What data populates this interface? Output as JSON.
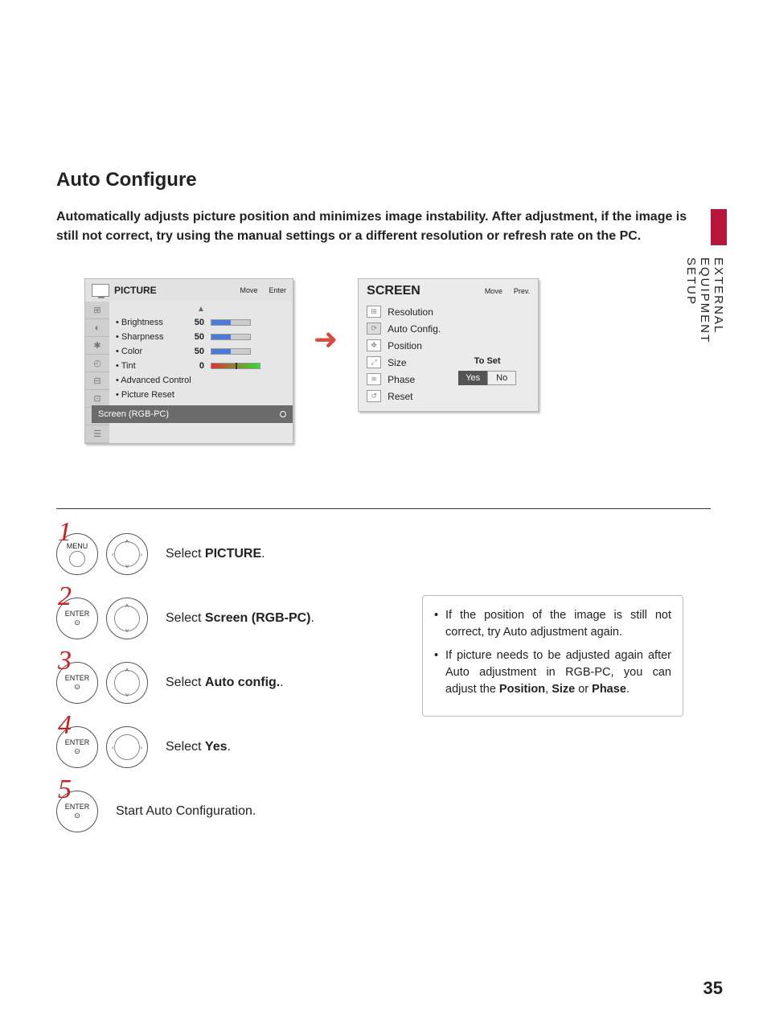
{
  "title": "Auto Configure",
  "intro": "Automatically adjusts picture position and minimizes image instability. After adjustment, if the image is still not correct, try using the manual settings or a different resolution or refresh rate on the PC.",
  "side_section": "EXTERNAL EQUIPMENT SETUP",
  "picture_menu": {
    "title": "PICTURE",
    "hints_move": "Move",
    "hints_enter": "Enter",
    "items": [
      {
        "label": "• Brightness",
        "value": "50",
        "fill": 50
      },
      {
        "label": "• Sharpness",
        "value": "50",
        "fill": 50
      },
      {
        "label": "• Color",
        "value": "50",
        "fill": 50
      }
    ],
    "tint_label": "• Tint",
    "tint_value": "0",
    "adv_label": "• Advanced Control",
    "reset_label": "• Picture Reset",
    "selected_label": "Screen (RGB-PC)"
  },
  "screen_menu": {
    "title": "SCREEN",
    "hints_move": "Move",
    "hints_prev": "Prev.",
    "rows": [
      "Resolution",
      "Auto Config.",
      "Position",
      "Size",
      "Phase",
      "Reset"
    ],
    "to_set": "To Set",
    "yes": "Yes",
    "no": "No"
  },
  "steps": [
    {
      "num": "1",
      "btn": "MENU",
      "dpad": "full",
      "text_pre": "Select ",
      "text_bold": "PICTURE",
      "text_post": "."
    },
    {
      "num": "2",
      "btn": "ENTER",
      "dpad": "ns",
      "text_pre": "Select ",
      "text_bold": "Screen (RGB-PC)",
      "text_post": "."
    },
    {
      "num": "3",
      "btn": "ENTER",
      "dpad": "ns",
      "text_pre": "Select ",
      "text_bold": "Auto config.",
      "text_post": "."
    },
    {
      "num": "4",
      "btn": "ENTER",
      "dpad": "ew",
      "text_pre": "Select ",
      "text_bold": "Yes",
      "text_post": "."
    },
    {
      "num": "5",
      "btn": "ENTER",
      "dpad": "",
      "text_pre": "Start Auto Configuration.",
      "text_bold": "",
      "text_post": ""
    }
  ],
  "tips": [
    "If the position of the image is still not correct, try Auto adjustment again.",
    {
      "pre": "If picture needs to be adjusted again after Auto adjustment in RGB-PC, you can adjust the ",
      "b1": "Position",
      "mid1": ", ",
      "b2": "Size",
      "mid2": " or ",
      "b3": "Phase",
      "post": "."
    }
  ],
  "page_number": "35"
}
